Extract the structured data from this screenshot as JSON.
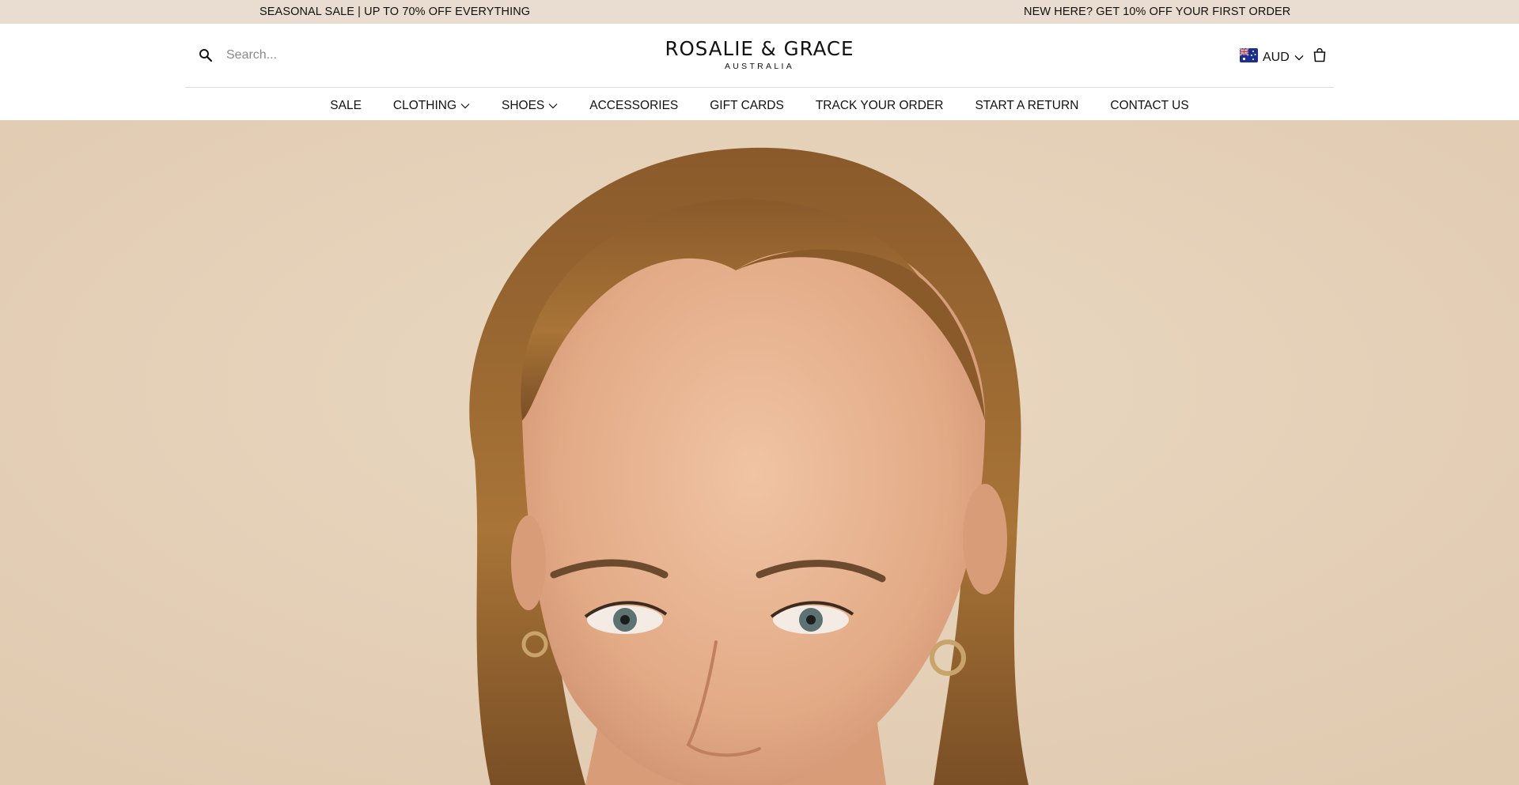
{
  "announcement": {
    "left": "SEASONAL SALE | UP TO 70% OFF EVERYTHING",
    "right": "NEW HERE? GET 10% OFF YOUR FIRST ORDER"
  },
  "header": {
    "search_placeholder": "Search...",
    "logo_name": "ROSALIE & GRACE",
    "logo_sub": "AUSTRALIA",
    "currency": "AUD",
    "icons": {
      "search": "search-icon",
      "flag": "australia-flag-icon",
      "currency_chevron": "chevron-down-icon",
      "cart": "shopping-bag-icon"
    }
  },
  "nav": {
    "items": [
      {
        "label": "SALE",
        "has_dropdown": false
      },
      {
        "label": "CLOTHING",
        "has_dropdown": true
      },
      {
        "label": "SHOES",
        "has_dropdown": true
      },
      {
        "label": "ACCESSORIES",
        "has_dropdown": false
      },
      {
        "label": "GIFT CARDS",
        "has_dropdown": false
      },
      {
        "label": "TRACK YOUR ORDER",
        "has_dropdown": false
      },
      {
        "label": "START A RETURN",
        "has_dropdown": false
      },
      {
        "label": "CONTACT US",
        "has_dropdown": false
      }
    ]
  },
  "colors": {
    "announcement_bg": "#e8ddd0",
    "header_bg": "#ffffff",
    "hero_bg": "#e3cfb6",
    "text": "#111111"
  }
}
